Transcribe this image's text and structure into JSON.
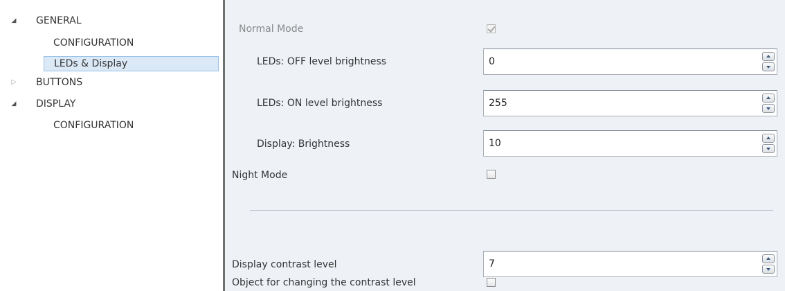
{
  "tree": {
    "items": [
      {
        "label": "GENERAL",
        "arrow": "expanded-triangle-icon"
      },
      {
        "label": "CONFIGURATION"
      },
      {
        "label": "LEDs & Display"
      },
      {
        "label": "BUTTONS",
        "arrow": "collapsed-triangle-icon"
      },
      {
        "label": "DISPLAY",
        "arrow": "expanded-triangle-icon"
      },
      {
        "label": "CONFIGURATION"
      }
    ],
    "selected_index": 2
  },
  "panel": {
    "normal_mode": {
      "label": "Normal Mode",
      "checked": true,
      "enabled": false
    },
    "led_off": {
      "label": "LEDs: OFF level brightness",
      "value": "0"
    },
    "led_on": {
      "label": "LEDs: ON level brightness",
      "value": "255"
    },
    "display_brightness": {
      "label": "Display: Brightness",
      "value": "10"
    },
    "night_mode": {
      "label": "Night Mode",
      "checked": false
    },
    "contrast": {
      "label": "Display contrast level",
      "value": "7"
    },
    "contrast_object": {
      "label": "Object for changing the contrast level",
      "checked": false
    }
  },
  "colors": {
    "panel_bg": "#eef2f7",
    "selection_bg": "#dbe8f6",
    "selection_border": "#99c1e8",
    "divider": "#6f6f6f"
  }
}
